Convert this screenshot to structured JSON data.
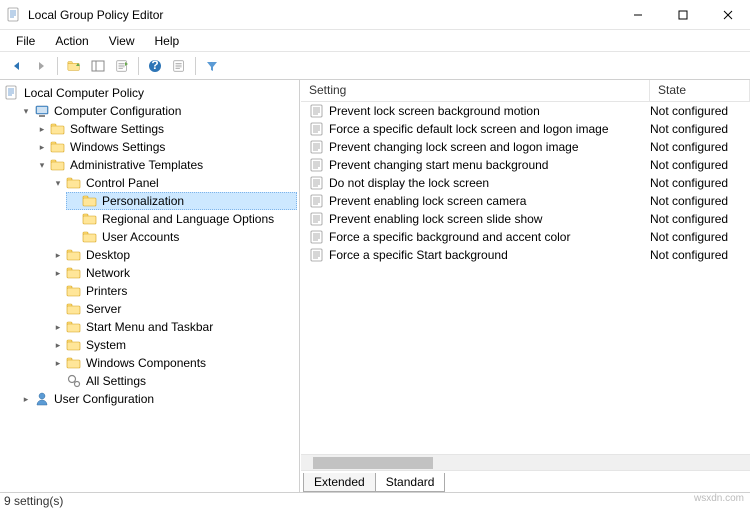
{
  "window": {
    "title": "Local Group Policy Editor"
  },
  "menu": {
    "file": "File",
    "action": "Action",
    "view": "View",
    "help": "Help"
  },
  "tree": {
    "root": "Local Computer Policy",
    "computer_config": "Computer Configuration",
    "software_settings": "Software Settings",
    "windows_settings": "Windows Settings",
    "admin_templates": "Administrative Templates",
    "control_panel": "Control Panel",
    "personalization": "Personalization",
    "regional": "Regional and Language Options",
    "user_accounts": "User Accounts",
    "desktop": "Desktop",
    "network": "Network",
    "printers": "Printers",
    "server": "Server",
    "start_taskbar": "Start Menu and Taskbar",
    "system": "System",
    "win_components": "Windows Components",
    "all_settings": "All Settings",
    "user_config": "User Configuration"
  },
  "columns": {
    "setting": "Setting",
    "state": "State"
  },
  "settings": [
    {
      "name": "Prevent lock screen background motion",
      "state": "Not configured"
    },
    {
      "name": "Force a specific default lock screen and logon image",
      "state": "Not configured"
    },
    {
      "name": "Prevent changing lock screen and logon image",
      "state": "Not configured"
    },
    {
      "name": "Prevent changing start menu background",
      "state": "Not configured"
    },
    {
      "name": "Do not display the lock screen",
      "state": "Not configured"
    },
    {
      "name": "Prevent enabling lock screen camera",
      "state": "Not configured"
    },
    {
      "name": "Prevent enabling lock screen slide show",
      "state": "Not configured"
    },
    {
      "name": "Force a specific background and accent color",
      "state": "Not configured"
    },
    {
      "name": "Force a specific Start background",
      "state": "Not configured"
    }
  ],
  "tabs": {
    "extended": "Extended",
    "standard": "Standard"
  },
  "status": "9 setting(s)"
}
